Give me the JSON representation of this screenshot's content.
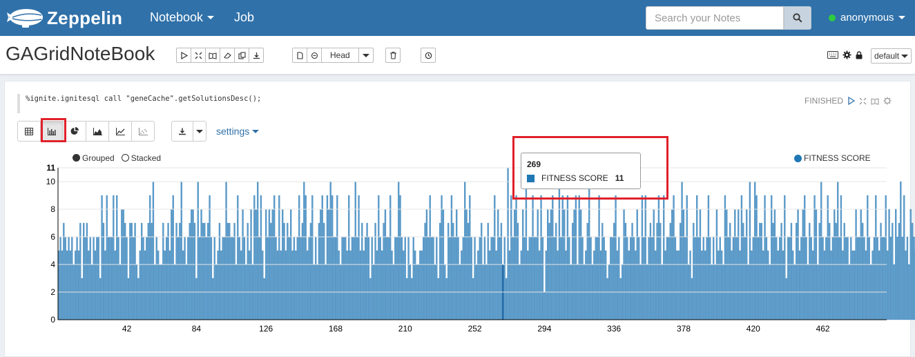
{
  "navbar": {
    "brand": "Zeppelin",
    "menu": [
      {
        "label": "Notebook",
        "dropdown": true
      },
      {
        "label": "Job",
        "dropdown": false
      }
    ],
    "search_placeholder": "Search your Notes",
    "user": "anonymous",
    "user_status_color": "#2ecc40"
  },
  "notebook": {
    "title": "GAGridNoteBook",
    "version_label": "Head",
    "interpreter_label": "default"
  },
  "paragraph": {
    "code": "%ignite.ignitesql call \"geneCache\".getSolutionsDesc();",
    "status": "FINISHED",
    "settings_label": "settings",
    "grouping": {
      "grouped": "Grouped",
      "stacked": "Stacked",
      "selected": "Grouped"
    }
  },
  "tooltip": {
    "x": "269",
    "series": "FITNESS SCORE",
    "value": "11"
  },
  "colors": {
    "navbar": "#3071a9",
    "bar": "#1f77b4",
    "highlight": "#e0202a"
  },
  "chart_data": {
    "type": "bar",
    "title": "",
    "series": [
      {
        "name": "FITNESS SCORE"
      }
    ],
    "x_start": 1,
    "x_end": 500,
    "x_ticks": [
      42,
      84,
      126,
      168,
      210,
      252,
      294,
      336,
      378,
      420,
      462
    ],
    "y_ticks": [
      0,
      2,
      4,
      6,
      8,
      10
    ],
    "ylim": [
      0,
      11
    ],
    "y_max_label": "11",
    "highlight": {
      "x": 269,
      "value": 11
    },
    "values": [
      5,
      6,
      5,
      7,
      6,
      5,
      6,
      5,
      6,
      4,
      5,
      6,
      5,
      7,
      3,
      7,
      6,
      7,
      5,
      6,
      4,
      6,
      5,
      6,
      6,
      3,
      9,
      7,
      5,
      9,
      6,
      6,
      6,
      9,
      5,
      9,
      6,
      4,
      8,
      8,
      7,
      6,
      3,
      7,
      7,
      6,
      7,
      4,
      3,
      5,
      7,
      6,
      5,
      6,
      7,
      9,
      7,
      10,
      4,
      6,
      5,
      4,
      4,
      7,
      5,
      6,
      7,
      5,
      8,
      9,
      4,
      7,
      6,
      7,
      10,
      5,
      6,
      4,
      6,
      7,
      8,
      8,
      7,
      3,
      10,
      6,
      8,
      7,
      7,
      6,
      7,
      9,
      6,
      3,
      6,
      4,
      5,
      7,
      5,
      6,
      6,
      10,
      7,
      7,
      6,
      6,
      7,
      4,
      9,
      6,
      5,
      8,
      6,
      4,
      7,
      5,
      8,
      4,
      9,
      8,
      10,
      6,
      9,
      5,
      3,
      8,
      6,
      8,
      7,
      8,
      9,
      6,
      5,
      9,
      5,
      8,
      7,
      5,
      7,
      6,
      8,
      5,
      6,
      5,
      6,
      9,
      6,
      7,
      10,
      9,
      5,
      6,
      7,
      9,
      4,
      6,
      4,
      7,
      8,
      9,
      7,
      4,
      9,
      8,
      10,
      9,
      6,
      6,
      9,
      5,
      4,
      6,
      6,
      6,
      5,
      9,
      5,
      6,
      6,
      10,
      6,
      9,
      5,
      7,
      5,
      6,
      7,
      6,
      3,
      6,
      4,
      7,
      5,
      9,
      6,
      5,
      7,
      8,
      6,
      6,
      9,
      5,
      4,
      6,
      6,
      10,
      9,
      6,
      5,
      6,
      3,
      6,
      4,
      3,
      6,
      5,
      4,
      4,
      5,
      5,
      6,
      7,
      8,
      6,
      9,
      6,
      6,
      4,
      6,
      3,
      7,
      9,
      8,
      4,
      3,
      7,
      6,
      9,
      7,
      6,
      8,
      6,
      4,
      5,
      6,
      10,
      8,
      7,
      9,
      6,
      3,
      6,
      4,
      5,
      6,
      7,
      4,
      6,
      4,
      7,
      5,
      6,
      6,
      9,
      5,
      8,
      6,
      7,
      4,
      6,
      3,
      11,
      5,
      9,
      6,
      8,
      9,
      7,
      4,
      5,
      8,
      6,
      10,
      5,
      6,
      6,
      9,
      6,
      6,
      8,
      5,
      9,
      6,
      2,
      5,
      8,
      7,
      8,
      9,
      6,
      7,
      5,
      10,
      6,
      9,
      8,
      5,
      9,
      6,
      4,
      7,
      8,
      9,
      4,
      9,
      8,
      6,
      4,
      5,
      7,
      10,
      6,
      4,
      5,
      6,
      6,
      9,
      5,
      7,
      6,
      5,
      3,
      4,
      6,
      6,
      7,
      9,
      5,
      6,
      3,
      4,
      8,
      7,
      6,
      5,
      6,
      7,
      6,
      5,
      8,
      6,
      4,
      9,
      6,
      9,
      4,
      6,
      7,
      6,
      8,
      5,
      7,
      9,
      7,
      4,
      9,
      5,
      6,
      6,
      7,
      8,
      9,
      6,
      5,
      5,
      7,
      10,
      8,
      6,
      9,
      4,
      5,
      3,
      7,
      6,
      9,
      6,
      8,
      5,
      6,
      5,
      6,
      9,
      6,
      4,
      6,
      4,
      8,
      5,
      6,
      5,
      4,
      9,
      8,
      6,
      7,
      5,
      6,
      8,
      6,
      8,
      5,
      9,
      7,
      6,
      8,
      4,
      10,
      5,
      6,
      10,
      9,
      6,
      7,
      7,
      5,
      9,
      6,
      5,
      4,
      9,
      7,
      8,
      6,
      5,
      6,
      7,
      5,
      9,
      3,
      6,
      6,
      7,
      5,
      4,
      7,
      8,
      5,
      6,
      8,
      9,
      6,
      4,
      7,
      6,
      5,
      9,
      8,
      4,
      7,
      10,
      6,
      5,
      6,
      9,
      7,
      5,
      6,
      8,
      7,
      10,
      6,
      9,
      5,
      7,
      6,
      6,
      4,
      6,
      5,
      5,
      8,
      6,
      6,
      8,
      7,
      6,
      5,
      9,
      6,
      4,
      5,
      6,
      9,
      6,
      5,
      7,
      6,
      6,
      9,
      5,
      8,
      6,
      7,
      4,
      8,
      6,
      7,
      10,
      6,
      9,
      5,
      6,
      4,
      8,
      7,
      6,
      5,
      7,
      8,
      9,
      6,
      5,
      7,
      7,
      6
    ]
  }
}
